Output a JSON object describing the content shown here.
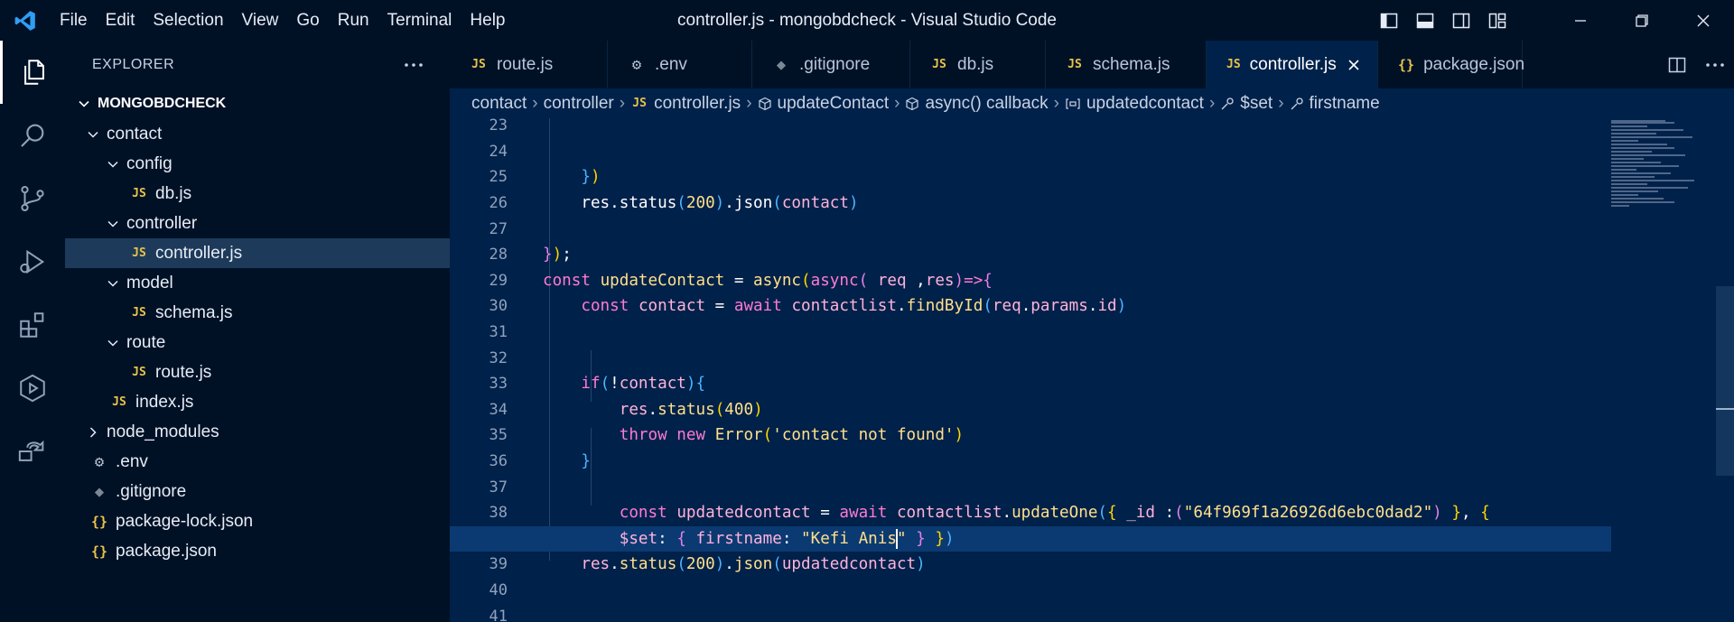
{
  "app": {
    "window_title": "controller.js - mongobdcheck - Visual Studio Code",
    "menu": [
      "File",
      "Edit",
      "Selection",
      "View",
      "Go",
      "Run",
      "Terminal",
      "Help"
    ],
    "title_icons": [
      "toggle-primary-sidebar-icon",
      "toggle-panel-icon",
      "toggle-secondary-sidebar-icon",
      "customize-layout-icon"
    ],
    "window_controls": [
      "minimize-icon",
      "restore-icon",
      "close-icon"
    ]
  },
  "activity_bar": [
    "explorer-icon",
    "search-icon",
    "source-control-icon",
    "run-debug-icon",
    "extensions-icon",
    "testing-icon",
    "remote-explorer-icon"
  ],
  "sidebar": {
    "title": "EXPLORER",
    "section": "MONGOBDCHECK",
    "tree": [
      {
        "label": "contact",
        "type": "folder",
        "depth": 0,
        "open": true
      },
      {
        "label": "config",
        "type": "folder",
        "depth": 1,
        "open": true
      },
      {
        "label": "db.js",
        "type": "js",
        "depth": 2
      },
      {
        "label": "controller",
        "type": "folder",
        "depth": 1,
        "open": true
      },
      {
        "label": "controller.js",
        "type": "js",
        "depth": 2,
        "selected": true
      },
      {
        "label": "model",
        "type": "folder",
        "depth": 1,
        "open": true
      },
      {
        "label": "schema.js",
        "type": "js",
        "depth": 2
      },
      {
        "label": "route",
        "type": "folder",
        "depth": 1,
        "open": true
      },
      {
        "label": "route.js",
        "type": "js",
        "depth": 2
      },
      {
        "label": "index.js",
        "type": "js",
        "depth": 1
      },
      {
        "label": "node_modules",
        "type": "folder",
        "depth": 0,
        "open": false
      },
      {
        "label": ".env",
        "type": "env",
        "depth": 0
      },
      {
        "label": ".gitignore",
        "type": "git",
        "depth": 0
      },
      {
        "label": "package-lock.json",
        "type": "json",
        "depth": 0
      },
      {
        "label": "package.json",
        "type": "json",
        "depth": 0
      }
    ]
  },
  "tabs": [
    {
      "label": "route.js",
      "type": "js"
    },
    {
      "label": ".env",
      "type": "env"
    },
    {
      "label": ".gitignore",
      "type": "git"
    },
    {
      "label": "db.js",
      "type": "js"
    },
    {
      "label": "schema.js",
      "type": "js"
    },
    {
      "label": "controller.js",
      "type": "js",
      "active": true
    },
    {
      "label": "package.json",
      "type": "json"
    }
  ],
  "breadcrumb": [
    "contact",
    "controller",
    "controller.js",
    "updateContact",
    "async() callback",
    "updatedcontact",
    "$set",
    "firstname"
  ],
  "editor": {
    "cursor_line": "38b",
    "lines": [
      {
        "n": "23",
        "t": [
          [
            "id",
            ""
          ]
        ]
      },
      {
        "n": "24",
        "t": [
          [
            "id",
            ""
          ]
        ]
      },
      {
        "n": "25",
        "t": [
          [
            "id",
            "    "
          ],
          [
            "b3",
            "}"
          ],
          [
            "b1",
            ")"
          ]
        ]
      },
      {
        "n": "26",
        "t": [
          [
            "id",
            "    res.status"
          ],
          [
            "b3",
            "("
          ],
          [
            "num",
            "200"
          ],
          [
            "b3",
            ")"
          ],
          [
            "id",
            ".json"
          ],
          [
            "b3",
            "("
          ],
          [
            "pr",
            "contact"
          ],
          [
            "b3",
            ")"
          ]
        ]
      },
      {
        "n": "27",
        "t": [
          [
            "id",
            ""
          ]
        ]
      },
      {
        "n": "28",
        "t": [
          [
            "b2",
            "}"
          ],
          [
            "b1",
            ")"
          ],
          [
            "id",
            ";"
          ]
        ]
      },
      {
        "n": "29",
        "t": [
          [
            "kw",
            "const "
          ],
          [
            "fn",
            "updateContact"
          ],
          [
            "id",
            " = "
          ],
          [
            "fn",
            "async"
          ],
          [
            "b1",
            "("
          ],
          [
            "kw",
            "async"
          ],
          [
            "b2",
            "("
          ],
          [
            "id",
            " "
          ],
          [
            "pr",
            "req"
          ],
          [
            "id",
            " ,"
          ],
          [
            "pr",
            "res"
          ],
          [
            "b2",
            ")"
          ],
          [
            "kw",
            "=>"
          ],
          [
            "b2",
            "{"
          ]
        ]
      },
      {
        "n": "30",
        "t": [
          [
            "id",
            "    "
          ],
          [
            "kw",
            "const "
          ],
          [
            "pr",
            "contact"
          ],
          [
            "id",
            " = "
          ],
          [
            "kw",
            "await "
          ],
          [
            "pr",
            "contactlist"
          ],
          [
            "id",
            "."
          ],
          [
            "fn",
            "findById"
          ],
          [
            "b3",
            "("
          ],
          [
            "pr",
            "req"
          ],
          [
            "id",
            "."
          ],
          [
            "pr",
            "params"
          ],
          [
            "id",
            "."
          ],
          [
            "pr",
            "id"
          ],
          [
            "b3",
            ")"
          ]
        ]
      },
      {
        "n": "31",
        "t": [
          [
            "id",
            ""
          ]
        ]
      },
      {
        "n": "32",
        "t": [
          [
            "id",
            ""
          ]
        ]
      },
      {
        "n": "33",
        "t": [
          [
            "id",
            "    "
          ],
          [
            "kw",
            "if"
          ],
          [
            "b3",
            "("
          ],
          [
            "id",
            "!"
          ],
          [
            "pr",
            "contact"
          ],
          [
            "b3",
            ")"
          ],
          [
            "b3",
            "{"
          ]
        ]
      },
      {
        "n": "34",
        "t": [
          [
            "id",
            "        "
          ],
          [
            "pr",
            "res"
          ],
          [
            "id",
            "."
          ],
          [
            "fn",
            "status"
          ],
          [
            "b1",
            "("
          ],
          [
            "num",
            "400"
          ],
          [
            "b1",
            ")"
          ]
        ]
      },
      {
        "n": "35",
        "t": [
          [
            "id",
            "        "
          ],
          [
            "kw",
            "throw new "
          ],
          [
            "fn",
            "Error"
          ],
          [
            "b1",
            "("
          ],
          [
            "str",
            "'contact not found'"
          ],
          [
            "b1",
            ")"
          ]
        ]
      },
      {
        "n": "36",
        "t": [
          [
            "id",
            "    "
          ],
          [
            "b3",
            "}"
          ]
        ]
      },
      {
        "n": "37",
        "t": [
          [
            "id",
            ""
          ]
        ]
      },
      {
        "n": "38",
        "t": [
          [
            "id",
            "        "
          ],
          [
            "kw",
            "const "
          ],
          [
            "pr",
            "updatedcontact"
          ],
          [
            "id",
            " = "
          ],
          [
            "kw",
            "await "
          ],
          [
            "pr",
            "contactlist"
          ],
          [
            "id",
            "."
          ],
          [
            "fn",
            "updateOne"
          ],
          [
            "b3",
            "("
          ],
          [
            "b1",
            "{"
          ],
          [
            "id",
            " "
          ],
          [
            "pr",
            "_id"
          ],
          [
            "id",
            " :"
          ],
          [
            "b2",
            "("
          ],
          [
            "str",
            "\"64f969f1a26926d6ebc0dad2\""
          ],
          [
            "b2",
            ")"
          ],
          [
            "id",
            " "
          ],
          [
            "b1",
            "}"
          ],
          [
            "id",
            ", "
          ],
          [
            "b1",
            "{"
          ]
        ]
      },
      {
        "n": "",
        "key": "38b",
        "t": [
          [
            "id",
            "        "
          ],
          [
            "pr",
            "$set"
          ],
          [
            "id",
            ": "
          ],
          [
            "b2",
            "{"
          ],
          [
            "id",
            " "
          ],
          [
            "pr",
            "firstname"
          ],
          [
            "id",
            ": "
          ],
          [
            "str",
            "\"Kefi Anis"
          ],
          [
            "cursor",
            ""
          ],
          [
            "str",
            "\""
          ],
          [
            "id",
            " "
          ],
          [
            "b2",
            "}"
          ],
          [
            "id",
            " "
          ],
          [
            "b1",
            "}"
          ],
          [
            "b3",
            ")"
          ]
        ]
      },
      {
        "n": "39",
        "t": [
          [
            "id",
            "    "
          ],
          [
            "pr",
            "res"
          ],
          [
            "id",
            "."
          ],
          [
            "fn",
            "status"
          ],
          [
            "b3",
            "("
          ],
          [
            "num",
            "200"
          ],
          [
            "b3",
            ")"
          ],
          [
            "id",
            "."
          ],
          [
            "fn",
            "json"
          ],
          [
            "b3",
            "("
          ],
          [
            "pr",
            "updatedcontact"
          ],
          [
            "b3",
            ")"
          ]
        ]
      },
      {
        "n": "40",
        "t": [
          [
            "id",
            ""
          ]
        ]
      },
      {
        "n": "41",
        "t": [
          [
            "id",
            ""
          ]
        ]
      }
    ]
  }
}
